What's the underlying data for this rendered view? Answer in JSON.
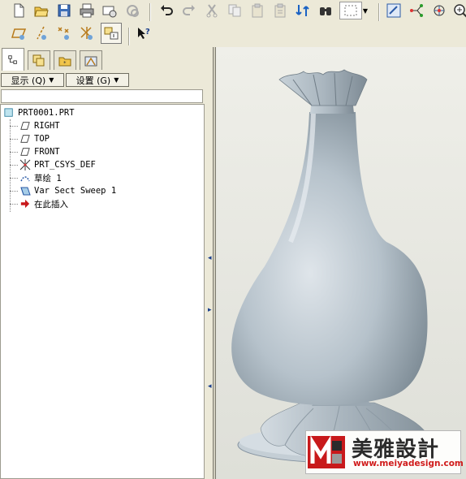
{
  "toolbar_top": {
    "icons": [
      "new-file-icon",
      "open-folder-icon",
      "save-icon",
      "print-icon",
      "send-email-icon",
      "link-icon",
      "undo-icon",
      "redo-icon",
      "cut-icon",
      "copy-icon",
      "paste-icon",
      "paste-special-icon",
      "regenerate-icon",
      "find-icon",
      "selection-box-icon",
      "view-refit-icon",
      "datum-display-icon",
      "orient-icon",
      "zoom-icon"
    ]
  },
  "toolbar_datum": {
    "icons": [
      "datum-plane-display-icon",
      "datum-axis-display-icon",
      "datum-point-display-icon",
      "csys-display-icon",
      "model-tree-toggle-icon",
      "context-help-icon"
    ]
  },
  "tabs": {
    "items": [
      "model-tree-tab",
      "layer-tab",
      "folder-browser-tab",
      "favorites-tab"
    ]
  },
  "settings": {
    "show_label": "显示 (Q)",
    "settings_label": "设置 (G)"
  },
  "filter": {
    "value": ""
  },
  "tree": {
    "root": "PRT0001.PRT",
    "items": [
      {
        "label": "RIGHT",
        "icon": "datum-plane-icon"
      },
      {
        "label": "TOP",
        "icon": "datum-plane-icon"
      },
      {
        "label": "FRONT",
        "icon": "datum-plane-icon"
      },
      {
        "label": "PRT_CSYS_DEF",
        "icon": "csys-icon"
      },
      {
        "label": "草绘 1",
        "icon": "sketch-icon"
      },
      {
        "label": "Var Sect Sweep 1",
        "icon": "sweep-icon"
      },
      {
        "label": "在此插入",
        "icon": "insert-here-arrow-icon"
      }
    ]
  },
  "watermark": {
    "title": "美雅設計",
    "url": "www.meiyadesign.com"
  },
  "colors": {
    "background": "#ece9d8",
    "model_surface": "#b8c4cc",
    "watermark_red": "#d01b1b"
  }
}
